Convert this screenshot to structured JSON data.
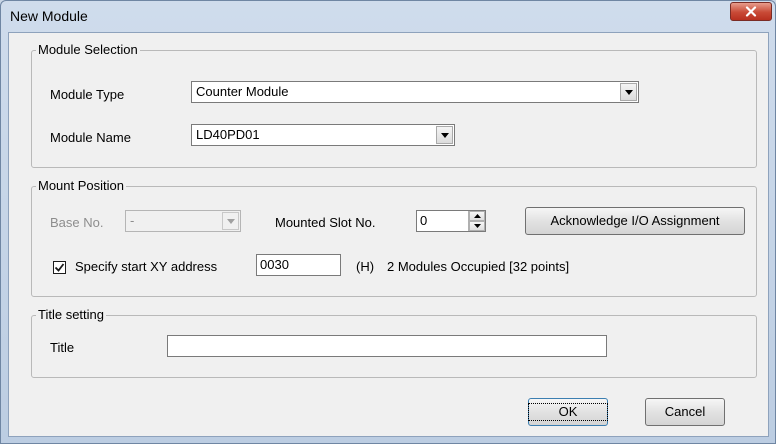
{
  "window": {
    "title": "New Module"
  },
  "module_selection": {
    "legend": "Module Selection",
    "module_type_label": "Module Type",
    "module_type_value": "Counter Module",
    "module_name_label": "Module Name",
    "module_name_value": "LD40PD01"
  },
  "mount_position": {
    "legend": "Mount Position",
    "base_no_label": "Base No.",
    "base_no_value": "-",
    "mounted_slot_label": "Mounted Slot No.",
    "mounted_slot_value": "0",
    "acknowledge_button": "Acknowledge I/O Assignment",
    "specify_start_checked": true,
    "specify_start_label": "Specify start XY address",
    "start_address_value": "0030",
    "hex_suffix": "(H)",
    "occupied_text": "2 Modules Occupied [32 points]"
  },
  "title_setting": {
    "legend": "Title setting",
    "title_label": "Title",
    "title_value": ""
  },
  "footer": {
    "ok_label": "OK",
    "cancel_label": "Cancel"
  }
}
